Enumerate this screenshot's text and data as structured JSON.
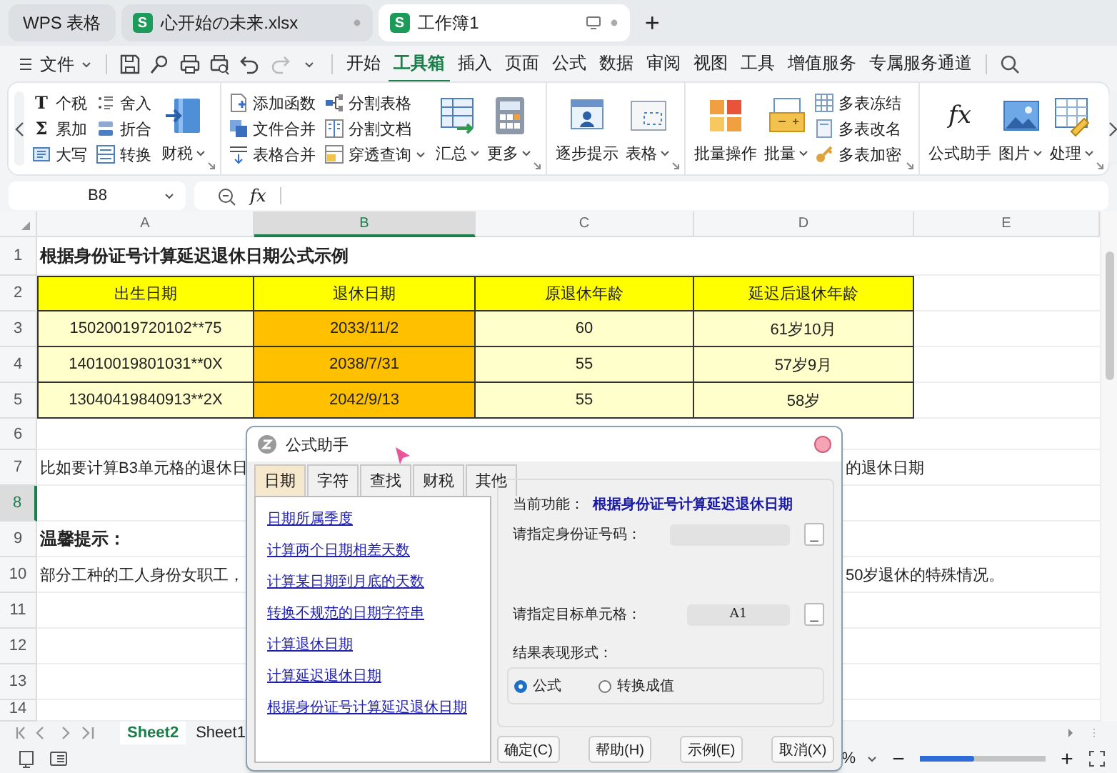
{
  "tabs": [
    {
      "label": "WPS 表格",
      "kind": "home",
      "selected": false
    },
    {
      "label": "心开始の未来.xlsx",
      "kind": "document",
      "badge": "S",
      "selected": false
    },
    {
      "label": "工作簿1",
      "kind": "document",
      "badge": "S",
      "selected": true
    }
  ],
  "new_tab": "+",
  "menu": {
    "file": "文件",
    "items": [
      {
        "label": "开始",
        "selected": false
      },
      {
        "label": "工具箱",
        "selected": true
      },
      {
        "label": "插入",
        "selected": false
      },
      {
        "label": "页面",
        "selected": false
      },
      {
        "label": "公式",
        "selected": false
      },
      {
        "label": "数据",
        "selected": false
      },
      {
        "label": "审阅",
        "selected": false
      },
      {
        "label": "视图",
        "selected": false
      },
      {
        "label": "工具",
        "selected": false
      },
      {
        "label": "增值服务",
        "selected": false
      },
      {
        "label": "专属服务通道",
        "selected": false
      }
    ]
  },
  "ribbon": {
    "groups": [
      {
        "columns": [
          {
            "kind": "stack",
            "items": [
              {
                "label": "个税",
                "glyph": "T",
                "dropdown": false
              },
              {
                "label": "累加",
                "glyph": "Σ",
                "dropdown": false
              },
              {
                "label": "大写",
                "dropdown": false
              }
            ]
          },
          {
            "kind": "stack",
            "items": [
              {
                "label": "舍入",
                "dropdown": false
              },
              {
                "label": "折合",
                "dropdown": false
              },
              {
                "label": "转换",
                "dropdown": false
              }
            ]
          },
          {
            "kind": "big",
            "label": "财税",
            "dropdown": true
          }
        ]
      },
      {
        "columns": [
          {
            "kind": "stack",
            "items": [
              {
                "label": "添加函数",
                "dropdown": false
              },
              {
                "label": "文件合并",
                "dropdown": false
              },
              {
                "label": "表格合并",
                "dropdown": false
              }
            ]
          },
          {
            "kind": "stack",
            "items": [
              {
                "label": "分割表格",
                "dropdown": false
              },
              {
                "label": "分割文档",
                "dropdown": false
              },
              {
                "label": "穿透查询",
                "dropdown": true
              }
            ]
          },
          {
            "kind": "big",
            "label": "汇总",
            "dropdown": true
          },
          {
            "kind": "big",
            "label": "更多",
            "dropdown": true
          }
        ]
      },
      {
        "columns": [
          {
            "kind": "big",
            "label": "逐步提示",
            "dropdown": false
          },
          {
            "kind": "big",
            "label": "表格",
            "dropdown": true
          }
        ]
      },
      {
        "columns": [
          {
            "kind": "big",
            "label": "批量操作",
            "dropdown": false
          },
          {
            "kind": "big",
            "label": "批量",
            "dropdown": true
          },
          {
            "kind": "stack",
            "items": [
              {
                "label": "多表冻结",
                "dropdown": false
              },
              {
                "label": "多表改名",
                "dropdown": false
              },
              {
                "label": "多表加密",
                "dropdown": false
              }
            ]
          }
        ]
      },
      {
        "columns": [
          {
            "kind": "big",
            "label": "公式助手",
            "glyph": "fx",
            "dropdown": false
          },
          {
            "kind": "big",
            "label": "图片",
            "dropdown": true
          },
          {
            "kind": "big",
            "label": "处理",
            "dropdown": true
          }
        ]
      }
    ]
  },
  "formula_bar": {
    "name_box": "B8",
    "fx": "fx"
  },
  "sheet": {
    "columns": [
      {
        "label": "A",
        "selected": false
      },
      {
        "label": "B",
        "selected": true
      },
      {
        "label": "C",
        "selected": false
      },
      {
        "label": "D",
        "selected": false
      },
      {
        "label": "E",
        "selected": false
      }
    ],
    "rows": [
      {
        "number": "1",
        "selected": false,
        "kind": "title",
        "text": "根据身份证号计算延迟退休日期公式示例"
      },
      {
        "number": "2",
        "selected": false,
        "kind": "table",
        "cells": [
          {
            "text": "出生日期",
            "color": "#ffff00"
          },
          {
            "text": "退休日期",
            "color": "#ffff00"
          },
          {
            "text": "原退休年龄",
            "color": "#ffff00"
          },
          {
            "text": "延迟后退休年龄",
            "color": "#ffff00"
          }
        ]
      },
      {
        "number": "3",
        "selected": false,
        "kind": "table",
        "cells": [
          {
            "text": "15020019720102**75",
            "color": "#ffffcc"
          },
          {
            "text": "2033/11/2",
            "color": "#ffc000"
          },
          {
            "text": "60",
            "color": "#ffffcc"
          },
          {
            "text": "61岁10月",
            "color": "#ffffcc"
          }
        ]
      },
      {
        "number": "4",
        "selected": false,
        "kind": "table",
        "cells": [
          {
            "text": "14010019801031**0X",
            "color": "#ffffcc"
          },
          {
            "text": "2038/7/31",
            "color": "#ffc000"
          },
          {
            "text": "55",
            "color": "#ffffcc"
          },
          {
            "text": "57岁9月",
            "color": "#ffffcc"
          }
        ]
      },
      {
        "number": "5",
        "selected": false,
        "kind": "table",
        "cells": [
          {
            "text": "13040419840913**2X",
            "color": "#ffffcc"
          },
          {
            "text": "2042/9/13",
            "color": "#ffc000"
          },
          {
            "text": "55",
            "color": "#ffffcc"
          },
          {
            "text": "58岁",
            "color": "#ffffcc"
          }
        ]
      },
      {
        "number": "6",
        "selected": false,
        "kind": "empty"
      },
      {
        "number": "7",
        "selected": false,
        "kind": "split_text",
        "left": "比如要计算B3单元格的退休日",
        "right": "的退休日期"
      },
      {
        "number": "8",
        "selected": true,
        "kind": "empty"
      },
      {
        "number": "9",
        "selected": false,
        "kind": "title",
        "text": "温馨提示："
      },
      {
        "number": "10",
        "selected": false,
        "kind": "split_text",
        "left": "部分工种的工人身份女职工，",
        "right": "50岁退休的特殊情况。"
      },
      {
        "number": "11",
        "selected": false,
        "kind": "empty"
      },
      {
        "number": "12",
        "selected": false,
        "kind": "empty"
      },
      {
        "number": "13",
        "selected": false,
        "kind": "empty"
      },
      {
        "number": "14",
        "selected": false,
        "kind": "empty"
      }
    ]
  },
  "sheet_tabs": [
    {
      "label": "Sheet2",
      "selected": true
    },
    {
      "label": "Sheet1",
      "selected": false
    }
  ],
  "status_bar": {
    "zoom_text": "%",
    "zoom_out": "−",
    "zoom_in": "+",
    "zoom": {
      "level": 0.43
    }
  },
  "dialog": {
    "title": "公式助手",
    "tabs": [
      {
        "label": "日期",
        "selected": true
      },
      {
        "label": "字符",
        "selected": false
      },
      {
        "label": "查找",
        "selected": false
      },
      {
        "label": "财税",
        "selected": false
      },
      {
        "label": "其他",
        "selected": false
      }
    ],
    "functions": [
      "日期所属季度",
      "计算两个日期相差天数",
      "计算某日期到月底的天数",
      "转换不规范的日期字符串",
      "计算退休日期",
      "计算延迟退休日期",
      "根据身份证号计算延迟退休日期"
    ],
    "current_label": "当前功能：",
    "current_value": "根据身份证号计算延迟退休日期",
    "fields": [
      {
        "label": "请指定身份证号码：",
        "button": "_"
      },
      {
        "label": "请指定目标单元格：",
        "value": "A1",
        "button": "_"
      }
    ],
    "result_label": "结果表现形式：",
    "options": [
      {
        "label": "公式",
        "selected": true
      },
      {
        "label": "转换成值",
        "selected": false
      }
    ],
    "buttons": [
      "确定(C)",
      "帮助(H)",
      "示例(E)",
      "取消(X)"
    ]
  }
}
